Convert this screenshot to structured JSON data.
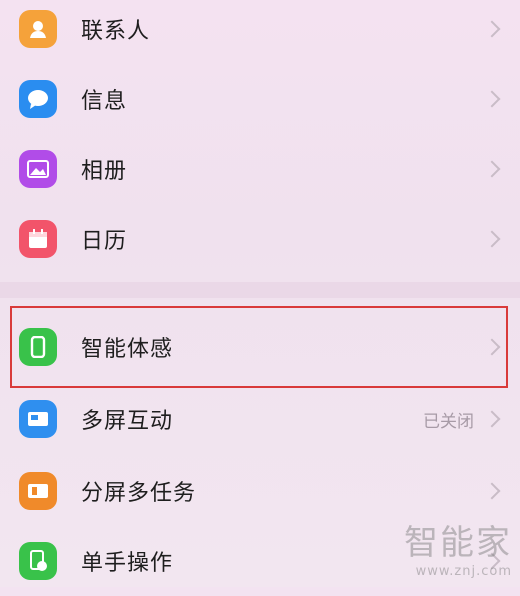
{
  "settings": {
    "items": [
      {
        "label": "联系人",
        "icon": "contacts-icon",
        "color": "#f5a23a"
      },
      {
        "label": "信息",
        "icon": "messages-icon",
        "color": "#2a8df0"
      },
      {
        "label": "相册",
        "icon": "gallery-icon",
        "color": "#b14ce8"
      },
      {
        "label": "日历",
        "icon": "calendar-icon",
        "color": "#f2546a"
      },
      {
        "label": "智能体感",
        "icon": "smart-motion-icon",
        "color": "#39c24a"
      },
      {
        "label": "多屏互动",
        "icon": "multi-screen-icon",
        "color": "#2f8fef",
        "status": "已关闭"
      },
      {
        "label": "分屏多任务",
        "icon": "split-screen-icon",
        "color": "#f08a2a"
      },
      {
        "label": "单手操作",
        "icon": "one-hand-icon",
        "color": "#39c24a"
      }
    ]
  },
  "highlight_color": "#d93a3a",
  "watermark": {
    "title": "智能家",
    "url": "www.znj.com"
  }
}
